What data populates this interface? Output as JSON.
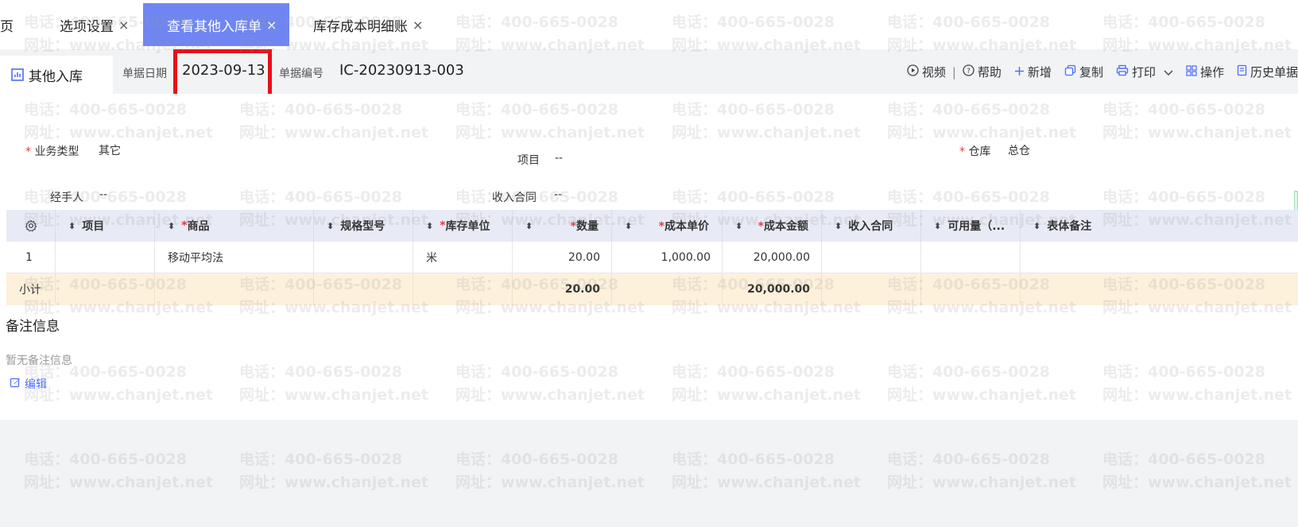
{
  "tabs": [
    {
      "label": "首页",
      "visible_text": "首页",
      "closable": false
    },
    {
      "label": "选项设置",
      "closable": true
    },
    {
      "label": "查看其他入库单",
      "closable": true,
      "active": true
    },
    {
      "label": "库存成本明细账",
      "closable": true
    }
  ],
  "close_glyph": "×",
  "doc_tab": {
    "label": "其他入库",
    "icon": "stock-in-icon"
  },
  "header": {
    "date_label": "单据日期",
    "date_value": "2023-09-13",
    "number_label": "单据编号",
    "number_value": "IC-20230913-003"
  },
  "toolbar": {
    "video": "视频",
    "divider": "|",
    "help": "帮助",
    "add": "新增",
    "copy": "复制",
    "print": "打印",
    "operate": "操作",
    "history": "历史单据"
  },
  "form": {
    "business_type_label": "业务类型",
    "business_type_value": "其它",
    "project_label": "项目",
    "project_value": "--",
    "warehouse_label": "仓库",
    "warehouse_value": "总仓",
    "handler_label": "经手人",
    "handler_value": "--",
    "income_contract_label": "收入合同",
    "income_contract_value": "--"
  },
  "required_mark": "*",
  "table": {
    "columns": [
      {
        "label": "项目",
        "required": false
      },
      {
        "label": "商品",
        "required": true
      },
      {
        "label": "规格型号",
        "required": false
      },
      {
        "label": "库存单位",
        "required": true
      },
      {
        "label": "数量",
        "required": true
      },
      {
        "label": "成本单价",
        "required": true
      },
      {
        "label": "成本金额",
        "required": true
      },
      {
        "label": "收入合同",
        "required": false
      },
      {
        "label": "可用量（...",
        "required": false
      },
      {
        "label": "表体备注",
        "required": false
      }
    ],
    "rows": [
      {
        "index": "1",
        "project": "",
        "product": "移动平均法",
        "spec": "",
        "unit": "米",
        "qty": "20.00",
        "unit_cost": "1,000.00",
        "amount": "20,000.00",
        "contract": "",
        "available": "",
        "remark": ""
      }
    ],
    "subtotal": {
      "label": "小计",
      "qty": "20.00",
      "amount": "20,000.00"
    }
  },
  "notes": {
    "title": "备注信息",
    "empty": "暂无备注信息",
    "edit": "编辑"
  },
  "watermark": {
    "line1": "电话：400-665-0028",
    "line2": "网址：www.chanjet.net"
  },
  "colors": {
    "active_tab": "#6f86f2",
    "accent": "#4a6cf7",
    "required": "#e4393c",
    "highlight_box": "#e8101a",
    "subtotal_bg": "#fdf1dc",
    "table_header_bg": "#e8ebf6"
  }
}
